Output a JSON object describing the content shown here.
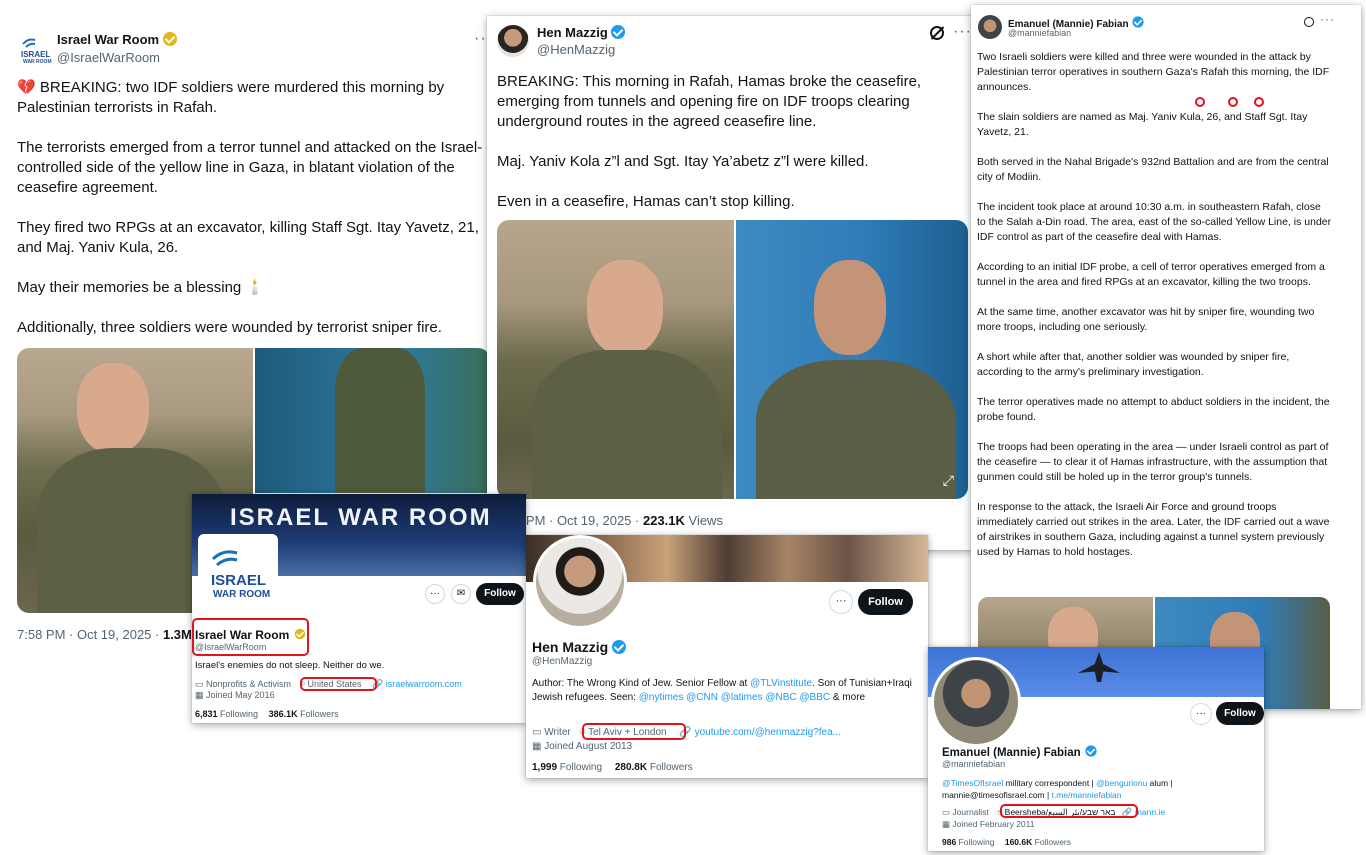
{
  "card1": {
    "name": "Israel War Room",
    "handle": "@IsraelWarRoom",
    "logo_text": "ISRAEL\nWAR ROOM",
    "para1": "BREAKING: two IDF soldiers were murdered this morning by Palestinian terrorists in Rafah.",
    "para2": "The terrorists emerged from a terror tunnel and attacked on the Israel-controlled side of the yellow line in Gaza, in blatant violation of the ceasefire agreement.",
    "para3": "They fired two RPGs at an excavator, killing Staff Sgt. Itay Yavetz, 21, and Maj. Yaniv Kula, 26.",
    "para4": "May their memories be a blessing",
    "para5": "Additionally, three soldiers were wounded by terrorist sniper fire.",
    "time": "7:58 PM · Oct 19, 2025 · ",
    "views": "1.3M V"
  },
  "card2": {
    "name": "Hen Mazzig",
    "handle": "@HenMazzig",
    "para1": "BREAKING: This morning in Rafah, Hamas broke the ceasefire, emerging from tunnels and opening fire on IDF troops clearing underground routes in the agreed ceasefire line.",
    "para2": "Maj. Yaniv Kola z”l and Sgt. Itay Ya’abetz z”l were killed.",
    "para3": "Even in a ceasefire, Hamas can’t stop killing.",
    "time": "8:00 PM · Oct 19, 2025 · ",
    "views_count": "223.1K",
    "views_label": " Views"
  },
  "card3": {
    "name": "Emanuel (Mannie) Fabian",
    "handle": "@manniefabian",
    "paras": [
      "Two Israeli soldiers were killed and three were wounded in the attack by Palestinian terror operatives in southern Gaza's Rafah this morning, the IDF announces.",
      "The slain soldiers are named as Maj. Yaniv Kula, 26, and Staff Sgt. Itay Yavetz, 21.",
      "Both served in the Nahal Brigade's 932nd Battalion and are from the central city of Modiin.",
      "The incident took place at around 10:30 a.m. in southeastern Rafah, close to the Salah a-Din road. The area, east of the so-called Yellow Line, is under IDF control as part of the ceasefire deal with Hamas.",
      "According to an initial IDF probe, a cell of terror operatives emerged from a tunnel in the area and fired RPGs at an excavator, killing the two troops.",
      "At the same time, another excavator was hit by sniper fire, wounding two more troops, including one seriously.",
      "A short while after that, another soldier was wounded by sniper fire, according to the army's preliminary investigation.",
      "The terror operatives made no attempt to abduct soldiers in the incident, the probe found.",
      "The troops had been operating in the area — under Israeli control as part of the ceasefire — to clear it of Hamas infrastructure, with the assumption that gunmen could still be holed up in the terror group's tunnels.",
      "In response to the attack, the Israeli Air Force and ground troops immediately carried out strikes in the area. Later, the IDF carried out a wave of airstrikes in southern Gaza, including against a tunnel system previously used by Hamas to hold hostages."
    ]
  },
  "profile1": {
    "banner_text": "ISRAEL WAR ROOM",
    "logo_text": "ISRAEL\nWAR ROOM",
    "name": "Israel War Room",
    "handle": "@IsraelWarRoom",
    "bio": "Israel's enemies do not sleep. Neither do we.",
    "category": "Nonprofits & Activism",
    "location": "United States",
    "website": "israelwarroom.com",
    "joined": "Joined May 2016",
    "following_count": "6,831",
    "following_label": " Following",
    "followers_count": "386.1K",
    "followers_label": " Followers",
    "follow_label": "Follow"
  },
  "profile2": {
    "name": "Hen Mazzig",
    "handle": "@HenMazzig",
    "bio_1": "Author: The Wrong Kind of Jew. Senior Fellow at ",
    "bio_link1": "@TLVinstitute",
    "bio_2": ". Son of Tunisian+Iraqi Jewish refugees. Seen: ",
    "bio_links2": "@nytimes @CNN @latimes @NBC @BBC",
    "bio_3": " & more",
    "category": "Writer",
    "location": "Tel Aviv + London",
    "website": "youtube.com/@henmazzig?fea...",
    "joined": "Joined August 2013",
    "following_count": "1,999",
    "following_label": " Following",
    "followers_count": "280.8K",
    "followers_label": " Followers",
    "follow_label": "Follow"
  },
  "profile3": {
    "name": "Emanuel (Mannie) Fabian",
    "handle": "@manniefabian",
    "bio_link1": "@TimesOfIsrael",
    "bio_1": " military correspondent  | ",
    "bio_link2": "@bengurionu",
    "bio_2": " alum |",
    "bio_3": "mannie@timesofisrael.com | ",
    "bio_link3": "t.me/manniefabian",
    "category": "Journalist",
    "location": "Beersheba/באר שבע/بئر السبع",
    "website": "mann.ie",
    "joined": "Joined February 2011",
    "following_count": "986",
    "following_label": " Following",
    "followers_count": "160.6K",
    "followers_label": " Followers",
    "follow_label": "Follow"
  },
  "colors": {
    "accent": "#1d9bf0",
    "highlight": "#e0141e",
    "verified_gold": "#e2b719"
  },
  "icons": [
    "verified-badge-icon",
    "more-icon",
    "grok-icon",
    "expand-icon",
    "briefcase-icon",
    "location-pin-icon",
    "link-icon",
    "calendar-icon",
    "mail-icon",
    "broken-heart-icon",
    "candle-icon"
  ]
}
